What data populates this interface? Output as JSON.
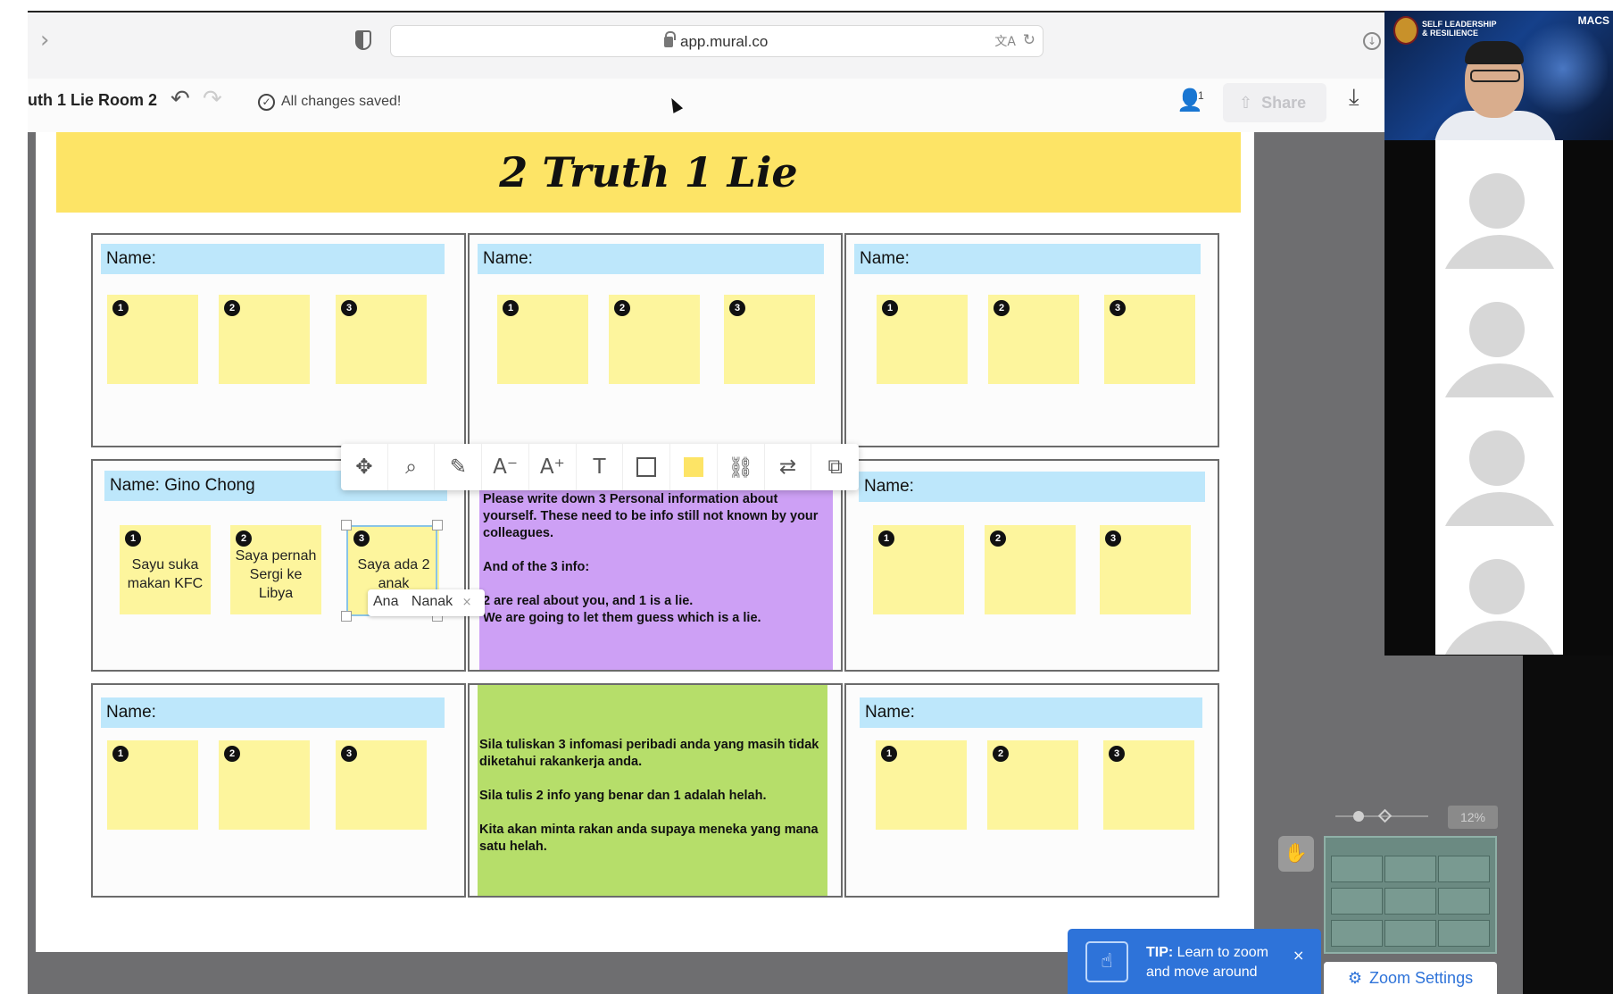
{
  "browser": {
    "url": "app.mural.co",
    "nav_forward_glyph": "›",
    "translate_glyph": "文A",
    "reload_glyph": "↻",
    "download_glyph": "↓"
  },
  "toolbar": {
    "title": "uth 1 Lie Room 2",
    "undo_glyph": "↶",
    "redo_glyph": "↷",
    "saved_status": "All changes saved!",
    "user_icon": "user-icon",
    "user_count": "1",
    "share_label": "Share",
    "share_glyph": "⇧",
    "export_glyph": "⤓"
  },
  "board": {
    "title": "2 Truth 1 Lie",
    "cells": [
      {
        "name": "Name:",
        "notes": [
          "",
          "",
          ""
        ]
      },
      {
        "name": "Name:",
        "notes": [
          "",
          "",
          ""
        ]
      },
      {
        "name": "Name:",
        "notes": [
          "",
          "",
          ""
        ]
      },
      {
        "name": "Name: Gino Chong",
        "notes": [
          "Sayu suka makan KFC",
          "Saya pernah Sergi ke Libya",
          "Saya ada 2 anak"
        ]
      },
      {
        "name": "Name:",
        "notes": [
          "",
          "",
          ""
        ]
      },
      {
        "name": "Name:",
        "notes": [
          "",
          "",
          ""
        ]
      },
      {
        "name": "Name:",
        "notes": [
          "",
          "",
          ""
        ]
      }
    ],
    "numbers": [
      "1",
      "2",
      "3"
    ],
    "instructions_en": {
      "line1": "Please write down 3 Personal information about yourself. These need to be info still not known by your colleagues.",
      "line2": "And of the 3 info:",
      "line3": "2 are real about you, and 1 is a lie.\nWe are going to let them guess which is a lie."
    },
    "instructions_ms": {
      "line1": "Sila tuliskan 3 infomasi peribadi anda yang masih tidak diketahui rakankerja anda.",
      "line2": "Sila tulis 2 info yang benar dan 1 adalah helah.",
      "line3": "Kita akan minta rakan anda supaya meneka yang mana satu helah."
    },
    "selection_tag": {
      "first": "Ana",
      "last": "Nanak",
      "close_glyph": "×"
    }
  },
  "floating_toolbar": {
    "tools": [
      {
        "name": "move-icon",
        "glyph": "✥"
      },
      {
        "name": "zoom-to-icon",
        "glyph": "⌕"
      },
      {
        "name": "pencil-icon",
        "glyph": "✎"
      },
      {
        "name": "font-decrease-icon",
        "glyph": "A⁻"
      },
      {
        "name": "font-increase-icon",
        "glyph": "A⁺"
      },
      {
        "name": "text-format-icon",
        "glyph": "T"
      },
      {
        "name": "shape-outline-icon",
        "glyph": ""
      },
      {
        "name": "color-swatch-icon",
        "glyph": ""
      },
      {
        "name": "link-icon",
        "glyph": "⛓"
      },
      {
        "name": "swap-icon",
        "glyph": "⇄"
      },
      {
        "name": "convert-icon",
        "glyph": "⧉"
      }
    ]
  },
  "zoom": {
    "percent": "12%",
    "hand_glyph": "✋"
  },
  "tip": {
    "label": "TIP:",
    "text": "Learn to zoom and move around",
    "close_glyph": "×",
    "icon_glyph": "☝"
  },
  "zoom_settings": {
    "label": "Zoom Settings",
    "glyph": "⚙"
  },
  "video": {
    "caption_line1": "SELF LEADERSHIP",
    "caption_line2": "& RESILIENCE",
    "brand": "MACS"
  },
  "colors": {
    "banner": "#fde466",
    "name_bar": "#bde7fb",
    "sticky": "#fdf59d",
    "purple_note": "#cda0f5",
    "green_note": "#b6de6a",
    "tip_blue": "#2e73d9"
  }
}
